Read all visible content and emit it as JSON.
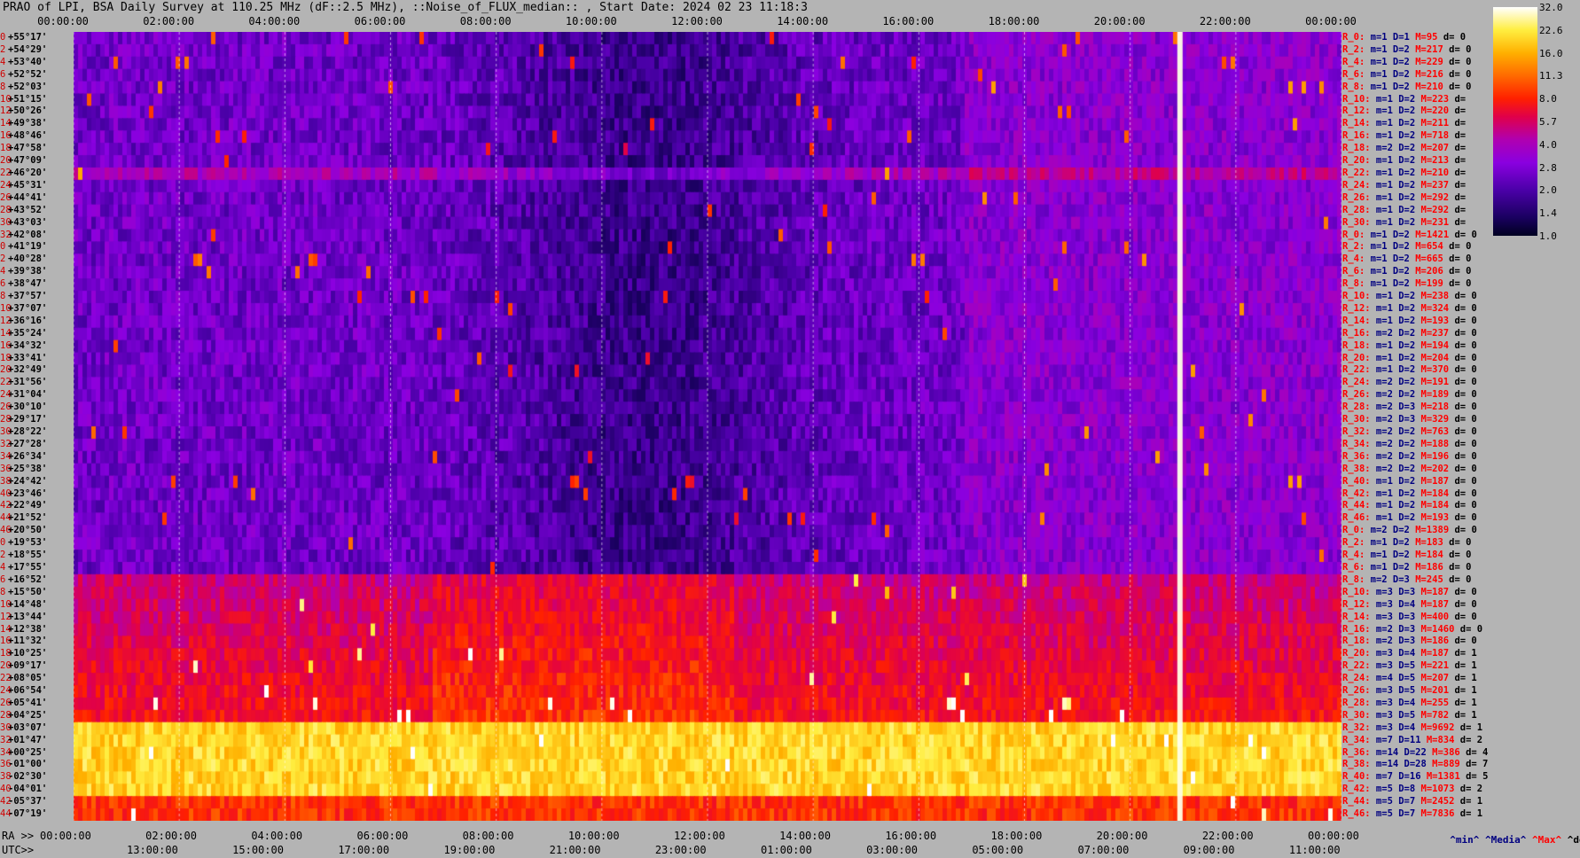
{
  "title": "PRAO of LPI, BSA Daily Survey at 110.25 MHz (dF::2.5 MHz), ::Noise_of_FLUX_median:: , Start Date: 2024 02 23 11:18:3",
  "chart_data": {
    "type": "heatmap",
    "x_top_ticks": [
      "00:00:00",
      "02:00:00",
      "04:00:00",
      "06:00:00",
      "08:00:00",
      "10:00:00",
      "12:00:00",
      "14:00:00",
      "16:00:00",
      "18:00:00",
      "20:00:00",
      "22:00:00",
      "00:00:00"
    ],
    "x_bottom_ra_ticks": [
      "00:00:00",
      "02:00:00",
      "04:00:00",
      "06:00:00",
      "08:00:00",
      "10:00:00",
      "12:00:00",
      "14:00:00",
      "16:00:00",
      "18:00:00",
      "20:00:00",
      "22:00:00",
      "00:00:00"
    ],
    "x_bottom_utc_ticks": [
      "13:00:00",
      "15:00:00",
      "17:00:00",
      "19:00:00",
      "21:00:00",
      "23:00:00",
      "01:00:00",
      "03:00:00",
      "05:00:00",
      "07:00:00",
      "09:00:00",
      "11:00:00"
    ],
    "ra_label": "RA >>",
    "utc_label": "UTC>>",
    "declinations": [
      "+55°17'",
      "+54°29'",
      "+53°40'",
      "+52°52'",
      "+52°03'",
      "+51°15'",
      "+50°26'",
      "+49°38'",
      "+48°46'",
      "+47°58'",
      "+47°09'",
      "+46°20'",
      "+45°31'",
      "+44°41'",
      "+43°52'",
      "+43°03'",
      "+42°08'",
      "+41°19'",
      "+40°28'",
      "+39°38'",
      "+38°47'",
      "+37°57'",
      "+37°07'",
      "+36°16'",
      "+35°24'",
      "+34°32'",
      "+33°41'",
      "+32°49'",
      "+31°56'",
      "+31°04'",
      "+30°10'",
      "+29°17'",
      "+28°22'",
      "+27°28'",
      "+26°34'",
      "+25°38'",
      "+24°42'",
      "+23°46'",
      "+22°49'",
      "+21°52'",
      "+20°50'",
      "+19°53'",
      "+18°55'",
      "+17°55'",
      "+16°52'",
      "+15°50'",
      "+14°48'",
      "+13°44'",
      "+12°38'",
      "+11°32'",
      "+10°25'",
      "+09°17'",
      "+08°05'",
      "+06°54'",
      "+05°41'",
      "+04°25'",
      "+03°07'",
      "+01°47'",
      "+00°25'",
      "-01°00'",
      "-02°30'",
      "-04°01'",
      "-05°37'",
      "-07°19'"
    ],
    "row_indices": [
      "0",
      "2",
      "4",
      "6",
      "8",
      "10",
      "12",
      "14",
      "16",
      "18",
      "20",
      "22",
      "24",
      "26",
      "28",
      "30",
      "32",
      "0",
      "2",
      "4",
      "6",
      "8",
      "10",
      "12",
      "14",
      "16",
      "18",
      "20",
      "22",
      "24",
      "26",
      "28",
      "30",
      "32",
      "34",
      "36",
      "38",
      "40",
      "42",
      "44",
      "46",
      "0",
      "2",
      "4",
      "6",
      "8",
      "10",
      "12",
      "14",
      "16",
      "18",
      "20",
      "22",
      "24",
      "26",
      "28",
      "30",
      "32",
      "34",
      "36",
      "38",
      "40",
      "42",
      "44"
    ],
    "colorbar": {
      "ticks": [
        "32.0",
        "22.6",
        "16.0",
        "11.3",
        "8.0",
        "5.7",
        "4.0",
        "2.8",
        "2.0",
        "1.4",
        "1.0"
      ],
      "colors": [
        "#000020",
        "#1a0060",
        "#4b00a8",
        "#8a00e0",
        "#b000b0",
        "#e0004a",
        "#ff2000",
        "#ff6a00",
        "#ffb000",
        "#ffee40",
        "#ffffff"
      ]
    },
    "rows": [
      {
        "r": "R_0:",
        "m": "m=1",
        "d": "D=1",
        "mx": "M=95",
        "dv": "d= 0"
      },
      {
        "r": "R_2:",
        "m": "m=1",
        "d": "D=2",
        "mx": "M=217",
        "dv": "d= 0"
      },
      {
        "r": "R_4:",
        "m": "m=1",
        "d": "D=2",
        "mx": "M=229",
        "dv": "d= 0"
      },
      {
        "r": "R_6:",
        "m": "m=1",
        "d": "D=2",
        "mx": "M=216",
        "dv": "d= 0"
      },
      {
        "r": "R_8:",
        "m": "m=1",
        "d": "D=2",
        "mx": "M=210",
        "dv": "d= 0"
      },
      {
        "r": "R_10:",
        "m": "m=1",
        "d": "D=2",
        "mx": "M=223",
        "dv": "d="
      },
      {
        "r": "R_12:",
        "m": "m=1",
        "d": "D=2",
        "mx": "M=220",
        "dv": "d="
      },
      {
        "r": "R_14:",
        "m": "m=1",
        "d": "D=2",
        "mx": "M=211",
        "dv": "d="
      },
      {
        "r": "R_16:",
        "m": "m=1",
        "d": "D=2",
        "mx": "M=718",
        "dv": "d="
      },
      {
        "r": "R_18:",
        "m": "m=2",
        "d": "D=2",
        "mx": "M=207",
        "dv": "d="
      },
      {
        "r": "R_20:",
        "m": "m=1",
        "d": "D=2",
        "mx": "M=213",
        "dv": "d="
      },
      {
        "r": "R_22:",
        "m": "m=1",
        "d": "D=2",
        "mx": "M=210",
        "dv": "d="
      },
      {
        "r": "R_24:",
        "m": "m=1",
        "d": "D=2",
        "mx": "M=237",
        "dv": "d="
      },
      {
        "r": "R_26:",
        "m": "m=1",
        "d": "D=2",
        "mx": "M=292",
        "dv": "d="
      },
      {
        "r": "R_28:",
        "m": "m=1",
        "d": "D=2",
        "mx": "M=292",
        "dv": "d="
      },
      {
        "r": "R_30:",
        "m": "m=1",
        "d": "D=2",
        "mx": "M=231",
        "dv": "d="
      },
      {
        "r": "R_0:",
        "m": "m=1",
        "d": "D=2",
        "mx": "M=1421",
        "dv": "d= 0"
      },
      {
        "r": "R_2:",
        "m": "m=1",
        "d": "D=2",
        "mx": "M=654",
        "dv": "d= 0"
      },
      {
        "r": "R_4:",
        "m": "m=1",
        "d": "D=2",
        "mx": "M=665",
        "dv": "d= 0"
      },
      {
        "r": "R_6:",
        "m": "m=1",
        "d": "D=2",
        "mx": "M=206",
        "dv": "d= 0"
      },
      {
        "r": "R_8:",
        "m": "m=1",
        "d": "D=2",
        "mx": "M=199",
        "dv": "d= 0"
      },
      {
        "r": "R_10:",
        "m": "m=1",
        "d": "D=2",
        "mx": "M=238",
        "dv": "d= 0"
      },
      {
        "r": "R_12:",
        "m": "m=1",
        "d": "D=2",
        "mx": "M=324",
        "dv": "d= 0"
      },
      {
        "r": "R_14:",
        "m": "m=1",
        "d": "D=2",
        "mx": "M=193",
        "dv": "d= 0"
      },
      {
        "r": "R_16:",
        "m": "m=2",
        "d": "D=2",
        "mx": "M=237",
        "dv": "d= 0"
      },
      {
        "r": "R_18:",
        "m": "m=1",
        "d": "D=2",
        "mx": "M=194",
        "dv": "d= 0"
      },
      {
        "r": "R_20:",
        "m": "m=1",
        "d": "D=2",
        "mx": "M=204",
        "dv": "d= 0"
      },
      {
        "r": "R_22:",
        "m": "m=1",
        "d": "D=2",
        "mx": "M=370",
        "dv": "d= 0"
      },
      {
        "r": "R_24:",
        "m": "m=2",
        "d": "D=2",
        "mx": "M=191",
        "dv": "d= 0"
      },
      {
        "r": "R_26:",
        "m": "m=2",
        "d": "D=2",
        "mx": "M=189",
        "dv": "d= 0"
      },
      {
        "r": "R_28:",
        "m": "m=2",
        "d": "D=3",
        "mx": "M=218",
        "dv": "d= 0"
      },
      {
        "r": "R_30:",
        "m": "m=2",
        "d": "D=3",
        "mx": "M=329",
        "dv": "d= 0"
      },
      {
        "r": "R_32:",
        "m": "m=2",
        "d": "D=2",
        "mx": "M=763",
        "dv": "d= 0"
      },
      {
        "r": "R_34:",
        "m": "m=2",
        "d": "D=2",
        "mx": "M=188",
        "dv": "d= 0"
      },
      {
        "r": "R_36:",
        "m": "m=2",
        "d": "D=2",
        "mx": "M=196",
        "dv": "d= 0"
      },
      {
        "r": "R_38:",
        "m": "m=2",
        "d": "D=2",
        "mx": "M=202",
        "dv": "d= 0"
      },
      {
        "r": "R_40:",
        "m": "m=1",
        "d": "D=2",
        "mx": "M=187",
        "dv": "d= 0"
      },
      {
        "r": "R_42:",
        "m": "m=1",
        "d": "D=2",
        "mx": "M=184",
        "dv": "d= 0"
      },
      {
        "r": "R_44:",
        "m": "m=1",
        "d": "D=2",
        "mx": "M=184",
        "dv": "d= 0"
      },
      {
        "r": "R_46:",
        "m": "m=1",
        "d": "D=2",
        "mx": "M=193",
        "dv": "d= 0"
      },
      {
        "r": "R_0:",
        "m": "m=2",
        "d": "D=2",
        "mx": "M=1389",
        "dv": "d= 0"
      },
      {
        "r": "R_2:",
        "m": "m=1",
        "d": "D=2",
        "mx": "M=183",
        "dv": "d= 0"
      },
      {
        "r": "R_4:",
        "m": "m=1",
        "d": "D=2",
        "mx": "M=184",
        "dv": "d= 0"
      },
      {
        "r": "R_6:",
        "m": "m=1",
        "d": "D=2",
        "mx": "M=186",
        "dv": "d= 0"
      },
      {
        "r": "R_8:",
        "m": "m=2",
        "d": "D=3",
        "mx": "M=245",
        "dv": "d= 0"
      },
      {
        "r": "R_10:",
        "m": "m=3",
        "d": "D=3",
        "mx": "M=187",
        "dv": "d= 0"
      },
      {
        "r": "R_12:",
        "m": "m=3",
        "d": "D=4",
        "mx": "M=187",
        "dv": "d= 0"
      },
      {
        "r": "R_14:",
        "m": "m=3",
        "d": "D=3",
        "mx": "M=400",
        "dv": "d= 0"
      },
      {
        "r": "R_16:",
        "m": "m=2",
        "d": "D=3",
        "mx": "M=1460",
        "dv": "d= 0"
      },
      {
        "r": "R_18:",
        "m": "m=2",
        "d": "D=3",
        "mx": "M=186",
        "dv": "d= 0"
      },
      {
        "r": "R_20:",
        "m": "m=3",
        "d": "D=4",
        "mx": "M=187",
        "dv": "d= 1"
      },
      {
        "r": "R_22:",
        "m": "m=3",
        "d": "D=5",
        "mx": "M=221",
        "dv": "d= 1"
      },
      {
        "r": "R_24:",
        "m": "m=4",
        "d": "D=5",
        "mx": "M=207",
        "dv": "d= 1"
      },
      {
        "r": "R_26:",
        "m": "m=3",
        "d": "D=5",
        "mx": "M=201",
        "dv": "d= 1"
      },
      {
        "r": "R_28:",
        "m": "m=3",
        "d": "D=4",
        "mx": "M=255",
        "dv": "d= 1"
      },
      {
        "r": "R_30:",
        "m": "m=3",
        "d": "D=5",
        "mx": "M=782",
        "dv": "d= 1"
      },
      {
        "r": "R_32:",
        "m": "m=3",
        "d": "D=4",
        "mx": "M=9692",
        "dv": "d= 1"
      },
      {
        "r": "R_34:",
        "m": "m=7",
        "d": "D=11",
        "mx": "M=834",
        "dv": "d= 2"
      },
      {
        "r": "R_36:",
        "m": "m=14",
        "d": "D=22",
        "mx": "M=386",
        "dv": "d= 4"
      },
      {
        "r": "R_38:",
        "m": "m=14",
        "d": "D=28",
        "mx": "M=889",
        "dv": "d= 7"
      },
      {
        "r": "R_40:",
        "m": "m=7",
        "d": "D=16",
        "mx": "M=1381",
        "dv": "d= 5"
      },
      {
        "r": "R_42:",
        "m": "m=5",
        "d": "D=8",
        "mx": "M=1073",
        "dv": "d= 2"
      },
      {
        "r": "R_44:",
        "m": "m=5",
        "d": "D=7",
        "mx": "M=2452",
        "dv": "d= 1"
      },
      {
        "r": "R_46:",
        "m": "m=5",
        "d": "D=7",
        "mx": "M=7836",
        "dv": "d= 1"
      }
    ],
    "legend_footer": {
      "min": "^min^",
      "median": "^Media^",
      "max": "^Max^",
      "devia": "^devia^"
    }
  }
}
